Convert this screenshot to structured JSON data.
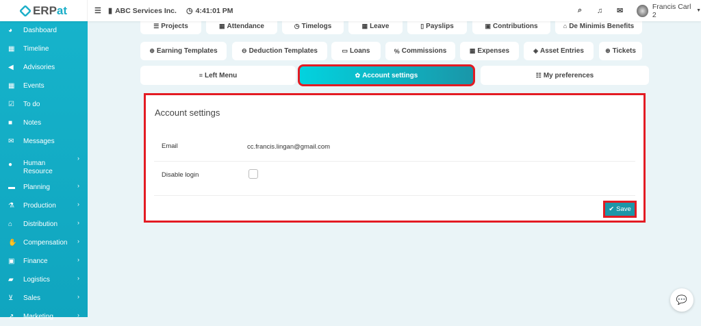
{
  "app": {
    "logo_text": "ERPat",
    "company": "ABC Services Inc.",
    "time": "4:41:01 PM",
    "user": "Francis Carl 2"
  },
  "sidebar": {
    "items": [
      {
        "label": "Dashboard",
        "icon": "dashboard-icon",
        "glyph": "◕",
        "sub": false
      },
      {
        "label": "Timeline",
        "icon": "timeline-icon",
        "glyph": "▦",
        "sub": false
      },
      {
        "label": "Advisories",
        "icon": "megaphone-icon",
        "glyph": "◀",
        "sub": false
      },
      {
        "label": "Events",
        "icon": "calendar-icon",
        "glyph": "▦",
        "sub": false
      },
      {
        "label": "To do",
        "icon": "checkbox-icon",
        "glyph": "☑",
        "sub": false
      },
      {
        "label": "Notes",
        "icon": "note-icon",
        "glyph": "■",
        "sub": false
      },
      {
        "label": "Messages",
        "icon": "envelope-icon",
        "glyph": "✉",
        "sub": false
      },
      {
        "label": "Human Resource",
        "icon": "users-icon",
        "glyph": "●",
        "sub": true
      },
      {
        "label": "Planning",
        "icon": "briefcase-icon",
        "glyph": "▬",
        "sub": true
      },
      {
        "label": "Production",
        "icon": "flask-icon",
        "glyph": "⚗",
        "sub": true
      },
      {
        "label": "Distribution",
        "icon": "building-icon",
        "glyph": "⌂",
        "sub": true
      },
      {
        "label": "Compensation",
        "icon": "handshake-icon",
        "glyph": "✋",
        "sub": true
      },
      {
        "label": "Finance",
        "icon": "money-icon",
        "glyph": "▣",
        "sub": true
      },
      {
        "label": "Logistics",
        "icon": "truck-icon",
        "glyph": "▰",
        "sub": true
      },
      {
        "label": "Sales",
        "icon": "cart-icon",
        "glyph": "⊻",
        "sub": true
      },
      {
        "label": "Marketing",
        "icon": "chart-icon",
        "glyph": "↗",
        "sub": true
      }
    ]
  },
  "tabs": {
    "row1": [
      {
        "label": "Projects",
        "glyph": "☰"
      },
      {
        "label": "Attendance",
        "glyph": "▦"
      },
      {
        "label": "Timelogs",
        "glyph": "◷"
      },
      {
        "label": "Leave",
        "glyph": "▦"
      },
      {
        "label": "Payslips",
        "glyph": "▯"
      },
      {
        "label": "Contributions",
        "glyph": "▣"
      },
      {
        "label": "De Minimis Benefits",
        "glyph": "⌂"
      }
    ],
    "row2": [
      {
        "label": "Earning Templates",
        "glyph": "⊕"
      },
      {
        "label": "Deduction Templates",
        "glyph": "⊖"
      },
      {
        "label": "Loans",
        "glyph": "▭"
      },
      {
        "label": "Commissions",
        "glyph": "%"
      },
      {
        "label": "Expenses",
        "glyph": "▦"
      },
      {
        "label": "Asset Entries",
        "glyph": "◈"
      },
      {
        "label": "Tickets",
        "glyph": "⊛"
      }
    ],
    "row3": [
      {
        "label": "Left Menu",
        "glyph": "≡"
      },
      {
        "label": "Account settings",
        "glyph": "✿"
      },
      {
        "label": "My preferences",
        "glyph": "☷"
      }
    ]
  },
  "panel": {
    "title": "Account settings",
    "email_label": "Email",
    "email_value": "cc.francis.lingan@gmail.com",
    "disable_label": "Disable login",
    "disable_checked": false,
    "save_label": "Save"
  }
}
